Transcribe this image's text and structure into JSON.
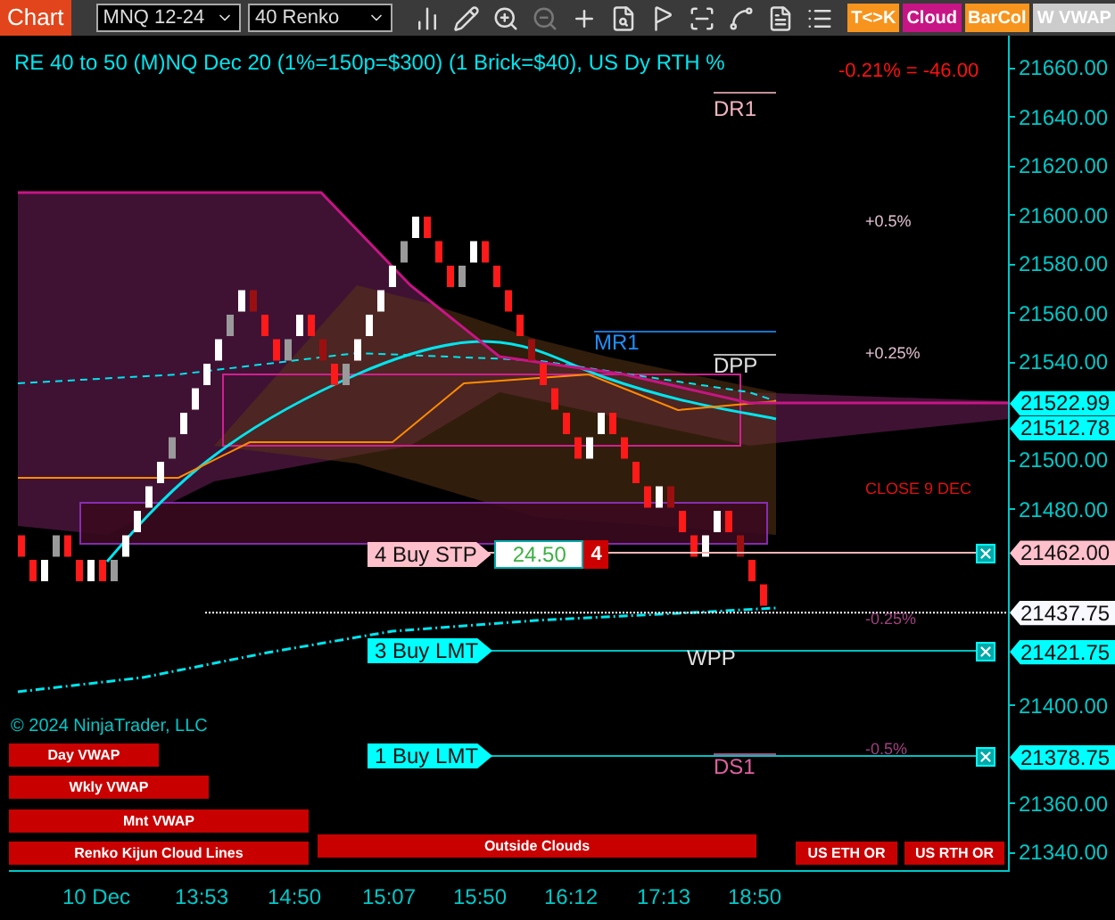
{
  "toolbar": {
    "chart_tab": "Chart",
    "instrument": "MNQ 12-24",
    "bar_type": "40 Renko",
    "buttons": [
      {
        "label": "T<>K",
        "color": "#f7941d"
      },
      {
        "label": "Cloud",
        "color": "#c71585"
      },
      {
        "label": "BarCol",
        "color": "#f7941d"
      },
      {
        "label": "W VWAP",
        "color": "#cccccc"
      }
    ]
  },
  "chart": {
    "title": "RE 40 to 50 (M)NQ Dec 20 (1%=150p=$300) (1 Brick=$40), US Dy RTH %",
    "pnl": "-0.21% = -46.00",
    "level_labels": [
      {
        "text": "DR1",
        "color": "#f0b4c0"
      },
      {
        "text": "MR1",
        "color": "#1e90ff"
      },
      {
        "text": "DPP",
        "color": "#e0e0e0"
      },
      {
        "text": "WPP",
        "color": "#e0e0e0"
      },
      {
        "text": "DS1",
        "color": "#e060a0"
      }
    ],
    "percent_labels": [
      "+0.5%",
      "+0.25%",
      "-0.25%",
      "-0.5%"
    ],
    "close_label": "CLOSE 9 DEC",
    "orders": [
      {
        "label": "4 Buy STP",
        "kind": "stop",
        "quantity": "24.50",
        "close": "4"
      },
      {
        "label": "3 Buy LMT",
        "kind": "limit"
      },
      {
        "label": "1 Buy LMT",
        "kind": "limit"
      }
    ],
    "copyright": "© 2024 NinjaTrader, LLC",
    "indicator_buttons": [
      "Day VWAP",
      "Wkly VWAP",
      "Mnt VWAP",
      "Renko Kijun Cloud Lines",
      "Outside Clouds",
      "US ETH OR",
      "US RTH OR"
    ]
  },
  "price_axis": {
    "ticks": [
      "21660.00",
      "21640.00",
      "21620.00",
      "21600.00",
      "21580.00",
      "21560.00",
      "21540.00",
      "21500.00",
      "21480.00",
      "21400.00",
      "21360.00",
      "21340.00"
    ],
    "tags": [
      {
        "text": "21522.99",
        "color": "#00ffff"
      },
      {
        "text": "21512.78",
        "color": "#00ffff"
      },
      {
        "text": "21462.00",
        "color": "#ffc0cb"
      },
      {
        "text": "21437.75",
        "color": "#f8f8ff"
      },
      {
        "text": "21421.75",
        "color": "#00ffff"
      },
      {
        "text": "21378.75",
        "color": "#00ffff"
      }
    ]
  },
  "time_axis": [
    "10 Dec",
    "13:53",
    "14:50",
    "15:07",
    "15:50",
    "16:12",
    "17:13",
    "18:50"
  ]
}
